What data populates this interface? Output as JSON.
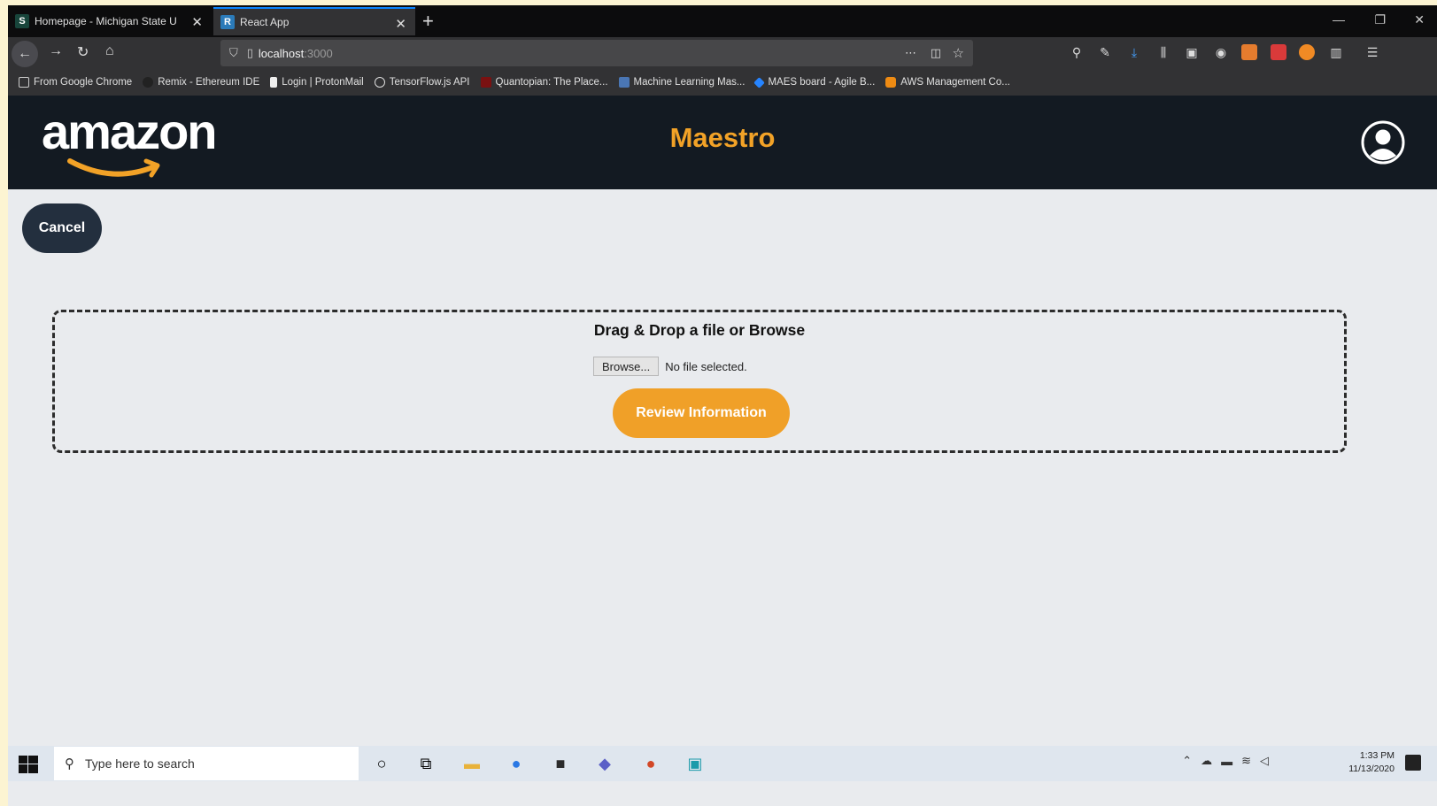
{
  "browser": {
    "tabs": [
      {
        "label": "Homepage - Michigan State U",
        "favicon": "S",
        "active": false
      },
      {
        "label": "React App",
        "favicon": "R",
        "active": true
      }
    ],
    "new_tab_symbol": "+",
    "url": "localhost",
    "url_port": ":3000",
    "bookmarks": [
      {
        "label": "From Google Chrome",
        "icon": "folder-icon"
      },
      {
        "label": "Remix - Ethereum IDE",
        "icon": "ethereum-icon"
      },
      {
        "label": "Login | ProtonMail",
        "icon": "lock-icon"
      },
      {
        "label": "TensorFlow.js API",
        "icon": "globe-icon"
      },
      {
        "label": "Quantopian: The Place...",
        "icon": "quantopian-icon"
      },
      {
        "label": "Machine Learning Mas...",
        "icon": "ml-icon"
      },
      {
        "label": "MAES board - Agile B...",
        "icon": "jira-icon"
      },
      {
        "label": "AWS Management Co...",
        "icon": "aws-icon"
      }
    ]
  },
  "app": {
    "logo_text": "amazon",
    "title": "Maestro",
    "accent_color": "#f2a227",
    "header_color": "#131a22"
  },
  "content": {
    "cancel_label": "Cancel",
    "dropzone_title": "Drag & Drop a file or Browse",
    "browse_label": "Browse...",
    "no_file_text": "No file selected.",
    "review_label": "Review Information"
  },
  "taskbar": {
    "search_placeholder": "Type here to search",
    "time": "1:33 PM",
    "date": "11/13/2020"
  }
}
